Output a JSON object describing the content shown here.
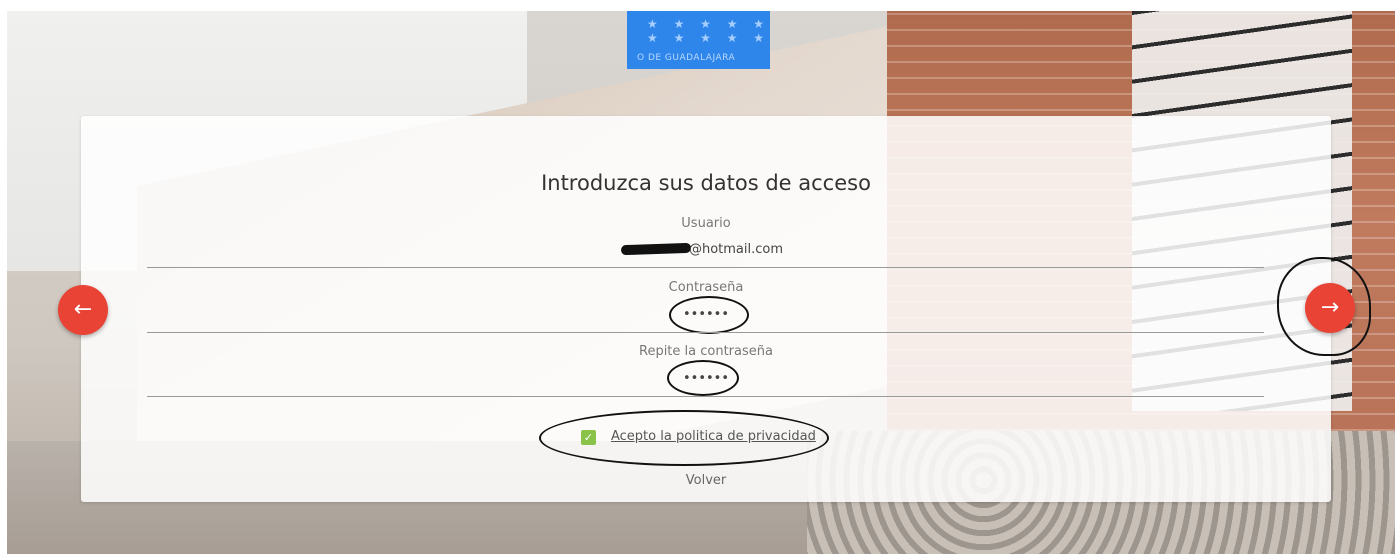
{
  "logo": {
    "stars": "★ ★ ★ ★ ★\n★ ★ ★ ★ ★",
    "caption": "O DE GUADALAJARA"
  },
  "form": {
    "title": "Introduzca sus datos de acceso",
    "user_label": "Usuario",
    "user_value": "@hotmail.com",
    "password_label": "Contraseña",
    "password_value": "••••••",
    "repeat_label": "Repite la contraseña",
    "repeat_value": "••••••",
    "privacy_label": "Acepto la politica de privacidad",
    "privacy_checked": true,
    "back_label": "Volver"
  },
  "nav": {
    "prev_icon": "arrow-left-icon",
    "next_icon": "arrow-right-icon",
    "accent_color": "#e94335"
  }
}
